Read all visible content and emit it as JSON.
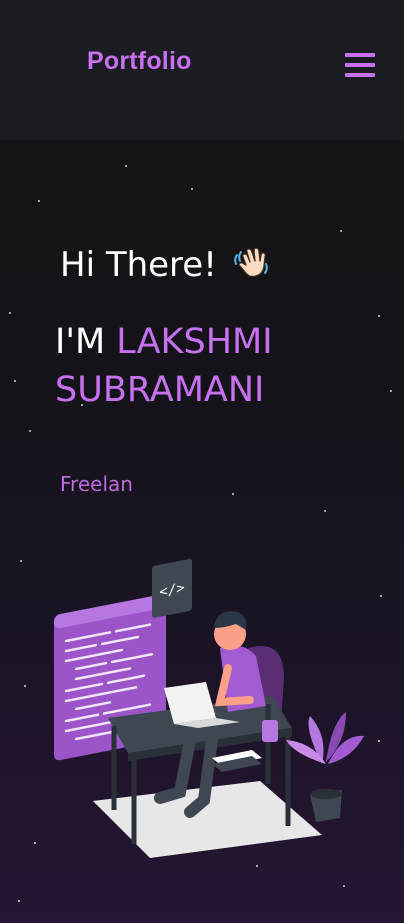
{
  "nav": {
    "logo": "Portfolio",
    "menu_icon": "hamburger-menu-icon"
  },
  "hero": {
    "greeting": "Hi There!",
    "greeting_icon": "waving-hand-icon",
    "name_prefix": "I'M",
    "name_first": "LAKSHMI",
    "name_last": "SUBRAMANI",
    "typewriter_text": "Freelan",
    "illustration": "developer-at-desk-illustration"
  },
  "colors": {
    "accent": "#c770f0",
    "nav_bg": "#1b1b22",
    "bg": "#141416"
  }
}
